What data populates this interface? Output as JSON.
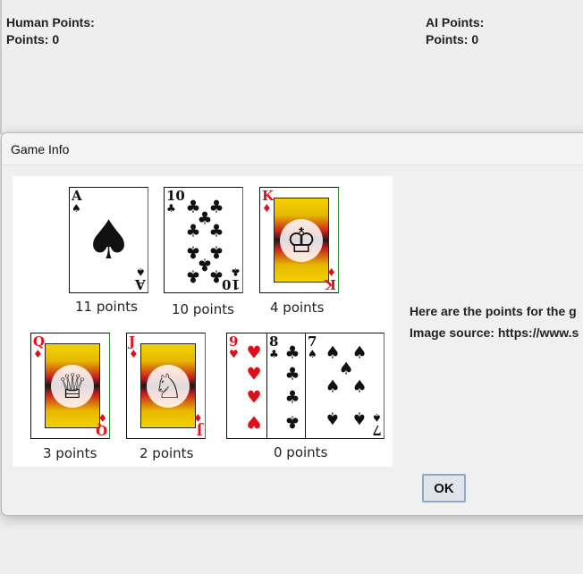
{
  "scores": {
    "human": {
      "title": "Human Points:",
      "points": "Points: 0"
    },
    "ai": {
      "title": "AI Points:",
      "points": "Points: 0"
    }
  },
  "dialog": {
    "title": "Game Info",
    "message_line1": "Here are the points for the g",
    "message_line2": "Image source: https://www.s",
    "ok_label": "OK"
  },
  "card_image": {
    "points_labels": [
      "11 points",
      "10 points",
      "4 points",
      "3 points",
      "2 points",
      "0 points"
    ],
    "cards": [
      {
        "rank": "A",
        "suit": "♠",
        "color": "black"
      },
      {
        "rank": "10",
        "suit": "♣",
        "color": "black"
      },
      {
        "rank": "K",
        "suit": "♦",
        "color": "red"
      },
      {
        "rank": "Q",
        "suit": "♦",
        "color": "red"
      },
      {
        "rank": "J",
        "suit": "♦",
        "color": "red"
      },
      {
        "rank": "9",
        "suit": "♥",
        "color": "red"
      },
      {
        "rank": "8",
        "suit": "♣",
        "color": "black"
      },
      {
        "rank": "7",
        "suit": "♠",
        "color": "black"
      }
    ]
  }
}
